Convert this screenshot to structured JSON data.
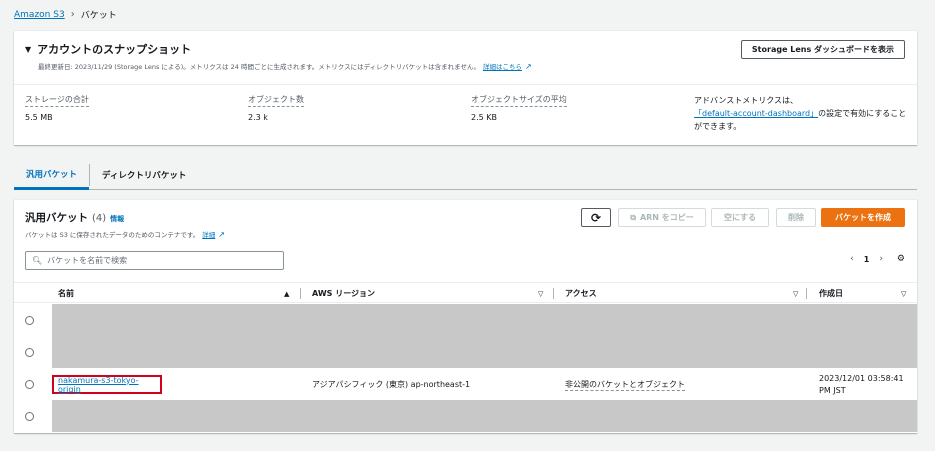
{
  "breadcrumb": {
    "root": "Amazon S3",
    "current": "バケット"
  },
  "snapshot": {
    "title": "アカウントのスナップショット",
    "subtitle": "最終更新日: 2023/11/29 (Storage Lens による)。メトリクスは 24 時間ごとに生成されます。メトリクスにはディレクトリバケットは含まれません。",
    "subtitle_link": "詳細はこちら",
    "dashboard_button": "Storage Lens ダッシュボードを表示",
    "metrics": [
      {
        "label": "ストレージの合計",
        "value": "5.5 MB"
      },
      {
        "label": "オブジェクト数",
        "value": "2.3 k"
      },
      {
        "label": "オブジェクトサイズの平均",
        "value": "2.5 KB"
      }
    ],
    "advanced_prefix": "アドバンストメトリクスは、",
    "advanced_link": "「default-account-dashboard」",
    "advanced_suffix": "の設定で有効にすることができます。"
  },
  "tabs": [
    {
      "label": "汎用バケット",
      "active": true
    },
    {
      "label": "ディレクトリバケット",
      "active": false
    }
  ],
  "buckets": {
    "title": "汎用バケット",
    "count": "(4)",
    "info": "情報",
    "description": "バケットは S3 に保存されたデータのためのコンテナです。",
    "description_link": "詳細",
    "buttons": {
      "copy_arn": "ARN をコピー",
      "empty": "空にする",
      "delete": "削除",
      "create": "バケットを作成"
    },
    "search_placeholder": "バケットを名前で検索",
    "page": "1",
    "columns": [
      "名前",
      "AWS リージョン",
      "アクセス",
      "作成日"
    ],
    "rows": [
      {
        "redacted": true
      },
      {
        "redacted": true
      },
      {
        "name": "nakamura-s3-tokyo-origin",
        "region": "アジアパシフィック (東京) ap-northeast-1",
        "access": "非公開のバケットとオブジェクト",
        "created_line1": "2023/12/01 03:58:41",
        "created_line2": "PM JST"
      },
      {
        "redacted": true
      }
    ]
  }
}
